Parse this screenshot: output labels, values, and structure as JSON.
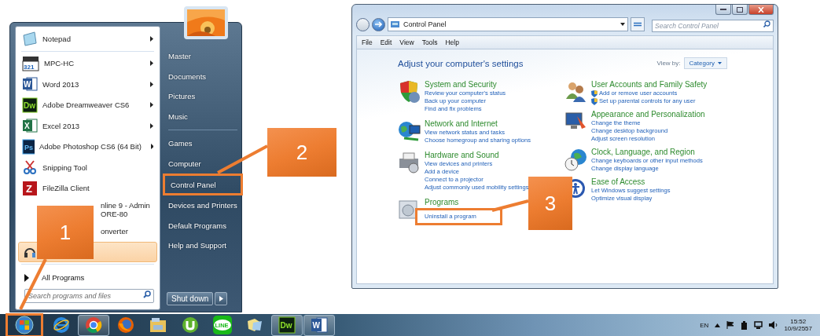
{
  "start_menu": {
    "programs": [
      {
        "label": "Notepad",
        "kind": "notepad",
        "submenu": true,
        "selected": false
      },
      {
        "label": "MPC-HC",
        "kind": "mpc",
        "icon_text": "321",
        "submenu": true,
        "selected": false
      },
      {
        "label": "Word 2013",
        "kind": "word",
        "icon_text": "W",
        "submenu": true,
        "selected": false
      },
      {
        "label": "Adobe Dreamweaver CS6",
        "kind": "dw",
        "icon_text": "Dw",
        "submenu": true,
        "selected": false
      },
      {
        "label": "Excel 2013",
        "kind": "excel",
        "icon_text": "X",
        "submenu": true,
        "selected": false
      },
      {
        "label": "Adobe Photoshop CS6 (64 Bit)",
        "kind": "ps",
        "icon_text": "Ps",
        "submenu": true,
        "selected": false
      },
      {
        "label": "Snipping Tool",
        "kind": "snip",
        "submenu": false,
        "selected": false
      },
      {
        "label": "FileZilla Client",
        "kind": "filezilla",
        "icon_text": "Z",
        "submenu": false,
        "selected": false
      },
      {
        "label": "nline 9 - Admin",
        "label_2": "ORE-80",
        "kind": "covered",
        "submenu": false,
        "selected": false
      },
      {
        "label": "onverter",
        "kind": "covered",
        "submenu": false,
        "selected": false
      },
      {
        "kind": "headset",
        "submenu": false,
        "selected": true
      }
    ],
    "all_programs": "All Programs",
    "search": {
      "placeholder": "Search programs and files"
    },
    "places": [
      {
        "items": [
          "Master",
          "Documents",
          "Pictures",
          "Music"
        ]
      },
      {
        "items": [
          "Games",
          "Computer",
          "Control Panel",
          "Devices and Printers",
          "Default Programs",
          "Help and Support"
        ]
      }
    ],
    "shutdown": "Shut down"
  },
  "control_panel": {
    "address": "Control Panel",
    "search_placeholder": "Search Control Panel",
    "menu": [
      "File",
      "Edit",
      "View",
      "Tools",
      "Help"
    ],
    "heading": "Adjust your computer's settings",
    "view_by_label": "View by:",
    "view_by_value": "Category",
    "columns": [
      [
        {
          "kind": "security",
          "title": "System and Security",
          "links": [
            {
              "text": "Review your computer's status",
              "shield": false
            },
            {
              "text": "Back up your computer",
              "shield": false
            },
            {
              "text": "Find and fix problems",
              "shield": false
            }
          ]
        },
        {
          "kind": "network",
          "title": "Network and Internet",
          "links": [
            {
              "text": "View network status and tasks",
              "shield": false
            },
            {
              "text": "Choose homegroup and sharing options",
              "shield": false
            }
          ]
        },
        {
          "kind": "hardware",
          "title": "Hardware and Sound",
          "links": [
            {
              "text": "View devices and printers",
              "shield": false
            },
            {
              "text": "Add a device",
              "shield": false
            },
            {
              "text": "Connect to a projector",
              "shield": false
            },
            {
              "text": "Adjust commonly used mobility settings",
              "shield": false
            }
          ]
        },
        {
          "kind": "programs",
          "title": "Programs",
          "links": [
            {
              "text": "Uninstall a program",
              "shield": false
            }
          ]
        }
      ],
      [
        {
          "kind": "users",
          "title": "User Accounts and Family Safety",
          "links": [
            {
              "text": "Add or remove user accounts",
              "shield": true
            },
            {
              "text": "Set up parental controls for any user",
              "shield": true
            }
          ]
        },
        {
          "kind": "appearance",
          "title": "Appearance and Personalization",
          "links": [
            {
              "text": "Change the theme",
              "shield": false
            },
            {
              "text": "Change desktop background",
              "shield": false
            },
            {
              "text": "Adjust screen resolution",
              "shield": false
            }
          ]
        },
        {
          "kind": "clock",
          "title": "Clock, Language, and Region",
          "links": [
            {
              "text": "Change keyboards or other input methods",
              "shield": false
            },
            {
              "text": "Change display language",
              "shield": false
            }
          ]
        },
        {
          "kind": "access",
          "title": "Ease of Access",
          "links": [
            {
              "text": "Let Windows suggest settings",
              "shield": false
            },
            {
              "text": "Optimize visual display",
              "shield": false
            }
          ]
        }
      ]
    ]
  },
  "taskbar": {
    "apps": [
      {
        "kind": "ie",
        "running": false
      },
      {
        "kind": "chrome",
        "running": true
      },
      {
        "kind": "firefox",
        "running": false
      },
      {
        "kind": "explorer",
        "running": false
      },
      {
        "kind": "utorrent",
        "running": false
      },
      {
        "kind": "line",
        "icon_text": "LINE",
        "running": false
      },
      {
        "kind": "folder",
        "running": false
      },
      {
        "kind": "dw",
        "icon_text": "Dw",
        "running": true
      },
      {
        "kind": "word",
        "icon_text": "W",
        "running": true
      }
    ],
    "tray": {
      "language": "EN",
      "time": "15:52",
      "date": "10/9/2557"
    }
  },
  "callouts": [
    "1",
    "2",
    "3"
  ]
}
